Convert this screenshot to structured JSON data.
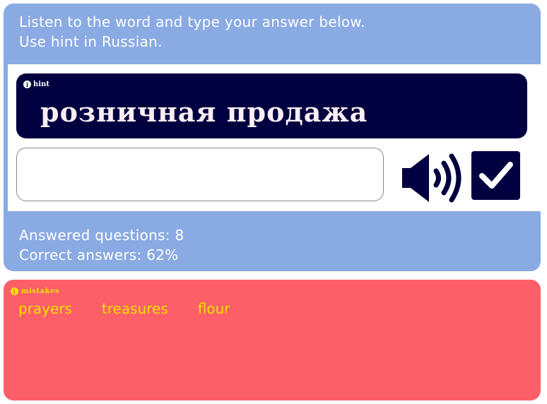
{
  "instructions": {
    "line1": "Listen to the word and type your answer below.",
    "line2": "Use hint in Russian."
  },
  "hint": {
    "label": "hint",
    "word": "розничная продажа"
  },
  "answer": {
    "value": "",
    "placeholder": ""
  },
  "stats": {
    "answered": "Answered questions: 8",
    "correct": "Correct answers: 62%"
  },
  "mistakes": {
    "label": "mistakes",
    "items": [
      "prayers",
      "treasures",
      "flour"
    ]
  },
  "icons": {
    "hint": "info-icon",
    "mistakes": "info-icon",
    "audio": "speaker-icon",
    "submit": "checkmark-icon"
  },
  "colors": {
    "top_panel": "#8aaae3",
    "hint_bg": "#000040",
    "hint_text": "#fbeef2",
    "bottom_panel": "#fc5f67",
    "mistake_text": "#f4e100",
    "button": "#000040"
  }
}
